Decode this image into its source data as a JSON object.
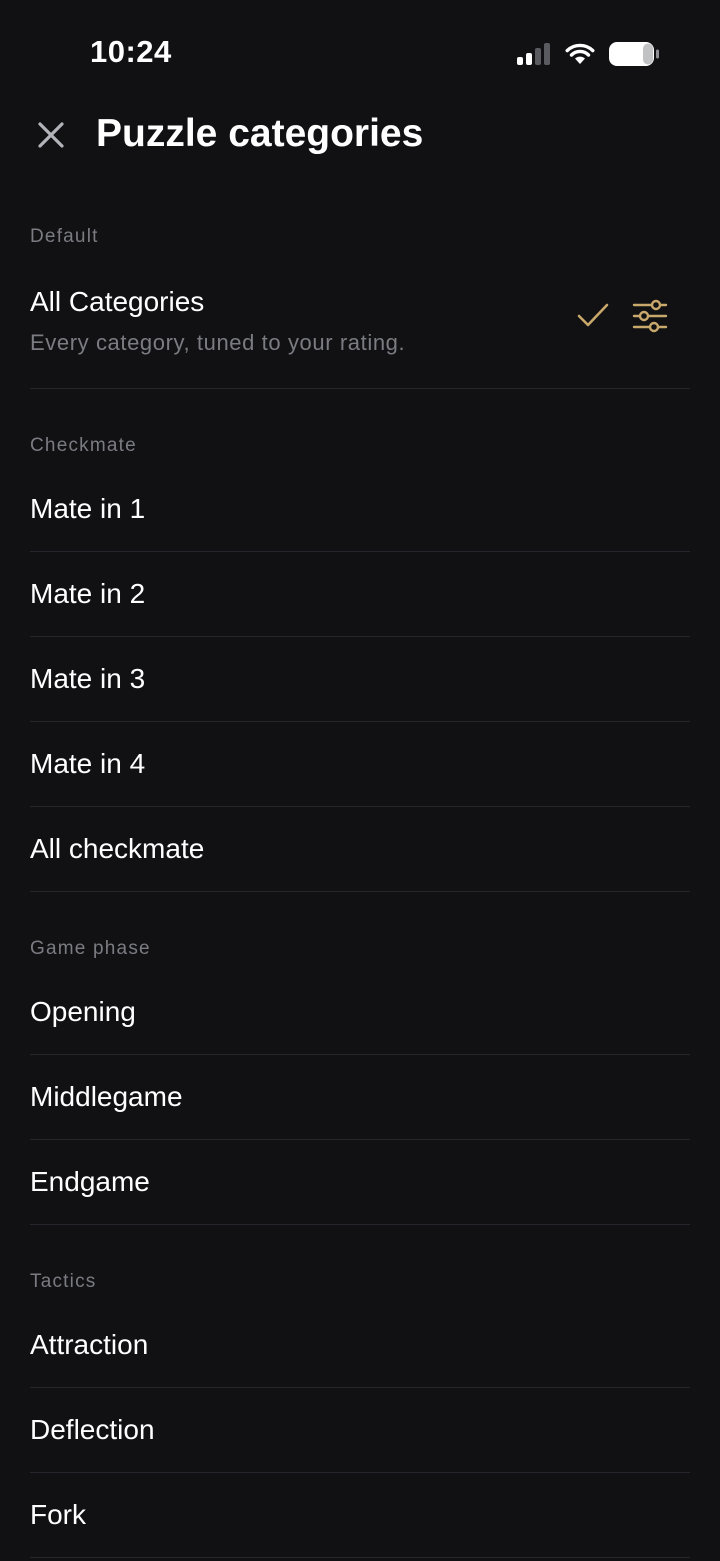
{
  "status_bar": {
    "time": "10:24",
    "icons": [
      "cellular-signal-icon",
      "wifi-icon",
      "battery-icon"
    ]
  },
  "header": {
    "close_icon": "close-icon",
    "title": "Puzzle categories"
  },
  "colors": {
    "background": "#111114",
    "accent_gold": "#c9a86b",
    "section_text": "#7b7c82",
    "divider": "#26272c"
  },
  "default_section": {
    "label": "Default",
    "item": {
      "title": "All Categories",
      "subtitle": "Every category, tuned to your rating.",
      "selected": true,
      "check_icon": "check-icon",
      "settings_icon": "sliders-icon"
    }
  },
  "sections": [
    {
      "label": "Checkmate",
      "items": [
        "Mate in 1",
        "Mate in 2",
        "Mate in 3",
        "Mate in 4",
        "All checkmate"
      ]
    },
    {
      "label": "Game phase",
      "items": [
        "Opening",
        "Middlegame",
        "Endgame"
      ]
    },
    {
      "label": "Tactics",
      "items": [
        "Attraction",
        "Deflection",
        "Fork"
      ]
    }
  ]
}
